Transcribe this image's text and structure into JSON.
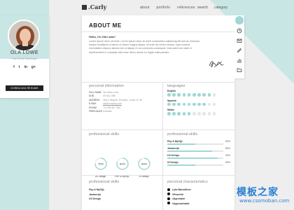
{
  "brand": {
    "logo_text": ".Carly"
  },
  "nav": {
    "items": [
      "about",
      "portfolio",
      "references",
      "search",
      "category"
    ]
  },
  "profile": {
    "name": "OLA LOWE",
    "role": "Front-End Developer",
    "socials": [
      "f",
      "t",
      "in",
      "g+"
    ],
    "contact_button": "DOWNLOAD RESUME"
  },
  "about": {
    "title": "ABOUT ME",
    "hello": "Hello, I'm Ola Lowe!",
    "intro": "Lorem Ipsum dolor sit amet, Lorem Ipsum dolor sit amet consectetur adipiscing elit sed do eiusmod tempor incididunt ut labore et dolore magna aliqua. Ut enim ad minim veniam, quis nostrud exercitation ullamco laboris nisi ut aliquip ex ea commodo consequat. Duis aute irure dolor in reprehenderit in voluptate velit esse cillum dolore eu fugiat nulla pariatur."
  },
  "personal_info": {
    "heading": "personal information",
    "rows": [
      {
        "key": "FULL NAME",
        "value": "Ola Maria Lowe"
      },
      {
        "key": "DOB",
        "value": "06 Sep 1986"
      },
      {
        "key": "ADDRESS",
        "value": "28/04, Belgium, Brussels, Louise 23, 65"
      },
      {
        "key": "E-MAIL",
        "value": "ola@company.com"
      },
      {
        "key": "PHONE",
        "value": "+12 986 987 7867"
      },
      {
        "key": "FREELANCE",
        "value": "Available"
      }
    ]
  },
  "languages": {
    "heading": "languages",
    "items": [
      {
        "name": "English",
        "level": 9
      },
      {
        "name": "Spanish",
        "level": 8
      },
      {
        "name": "Italian",
        "level": 5
      }
    ],
    "max": 10,
    "filled_color": "#9fd8d4",
    "empty_color": "#e6e6e6"
  },
  "circle_skills": {
    "heading": "professional skills",
    "items": [
      {
        "label": "UX Design",
        "value": 75
      },
      {
        "label": "PHP & MySQL",
        "value": 81
      },
      {
        "label": "UI Design",
        "value": 90
      }
    ]
  },
  "bar_skills": {
    "heading": "professional skills",
    "items": [
      {
        "label": "Php & MySQL",
        "value": 50
      },
      {
        "label": "Javascript",
        "value": 80
      },
      {
        "label": "UX Design",
        "value": 90
      },
      {
        "label": "UI Design",
        "value": 50
      }
    ]
  },
  "pro_skills": {
    "heading": "professional skills",
    "items": [
      "Php & MySQL",
      "Javascript",
      "UX Design"
    ]
  },
  "characteristics": {
    "heading": "personal characteristics",
    "items": [
      "Lyke Marseillese",
      "#Peaceful",
      "#Agreeable",
      "#Approachable"
    ]
  },
  "watermark": {
    "text": "模板之家",
    "url": "www.cssmoban.com"
  },
  "colors": {
    "accent": "#9fd8d4",
    "background_blue": "#c8e6e4",
    "dark": "#222222"
  },
  "rail_icons": [
    "avatar-icon",
    "clock-icon",
    "mail-icon",
    "pencil-icon",
    "chart-icon",
    "folder-icon"
  ]
}
